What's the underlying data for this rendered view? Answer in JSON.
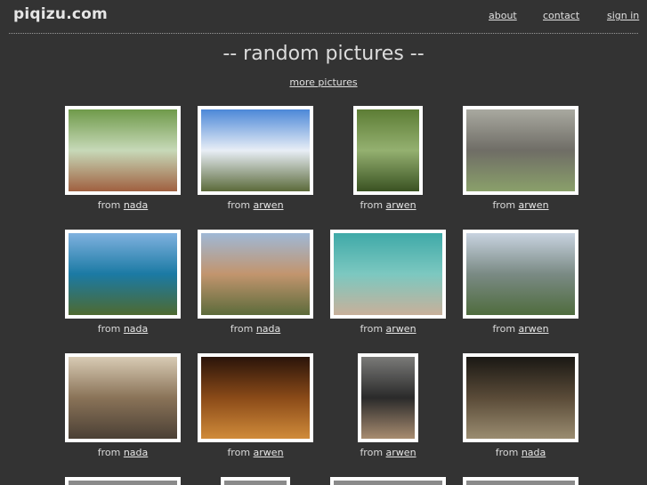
{
  "site": {
    "title": "piqizu.com"
  },
  "nav": {
    "about": "about",
    "contact": "contact",
    "sign_in": "sign in"
  },
  "page": {
    "heading": "-- random pictures --",
    "more_link": "more pictures"
  },
  "caption_prefix": "from",
  "pictures": [
    {
      "user": "nada",
      "scene": "park path with trees",
      "colors": [
        "#6f9a4a",
        "#c7d9b8",
        "#a06040"
      ]
    },
    {
      "user": "arwen",
      "scene": "field under cloudy sky",
      "colors": [
        "#4c88d8",
        "#e8eef6",
        "#5b6a3a"
      ]
    },
    {
      "user": "arwen",
      "scene": "tree foliage",
      "colors": [
        "#5d7d35",
        "#94b070",
        "#3a5222"
      ]
    },
    {
      "user": "arwen",
      "scene": "fountain in plaza",
      "colors": [
        "#a9a9a0",
        "#6f6d66",
        "#8aa06a"
      ]
    },
    {
      "user": "nada",
      "scene": "coastal cliffs and bay",
      "colors": [
        "#7fb1df",
        "#1b7aa4",
        "#4e6a30"
      ]
    },
    {
      "user": "nada",
      "scene": "desert road with palms",
      "colors": [
        "#9fb8d6",
        "#c2956e",
        "#5c6b3b"
      ]
    },
    {
      "user": "arwen",
      "scene": "turquoise sea and rocks",
      "colors": [
        "#3fa9a8",
        "#7cc8c0",
        "#c8b09a"
      ]
    },
    {
      "user": "arwen",
      "scene": "city view with bridge",
      "colors": [
        "#c8d3e0",
        "#7a8a84",
        "#4f6c3e"
      ]
    },
    {
      "user": "nada",
      "scene": "narrow street with people",
      "colors": [
        "#d8cbb4",
        "#8a7358",
        "#4b4035"
      ]
    },
    {
      "user": "arwen",
      "scene": "lit cave interior",
      "colors": [
        "#2a140a",
        "#8a4a18",
        "#d08b3a"
      ]
    },
    {
      "user": "arwen",
      "scene": "gondolier in canal",
      "colors": [
        "#7a7a78",
        "#2a2a2a",
        "#a88c70"
      ]
    },
    {
      "user": "nada",
      "scene": "dark church interior",
      "colors": [
        "#1a1814",
        "#5a4b38",
        "#9a8c70"
      ]
    }
  ]
}
